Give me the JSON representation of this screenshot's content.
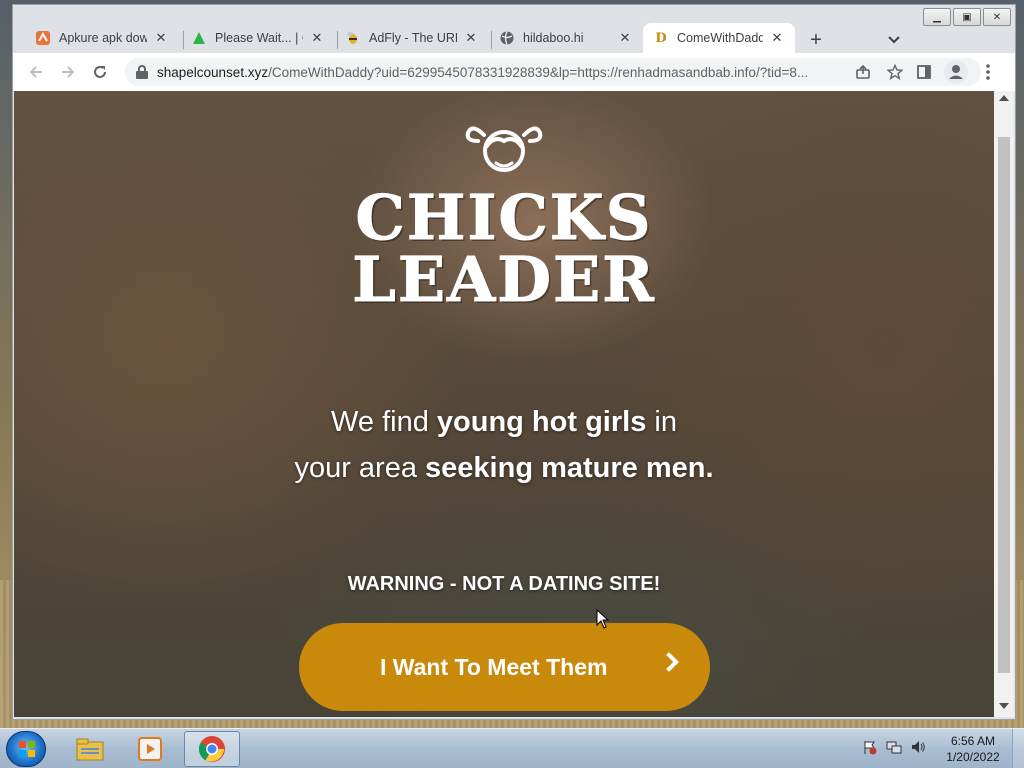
{
  "browser": {
    "tabs": [
      {
        "label": "Apkure apk dow",
        "favicon": "apkure-favicon",
        "active": false
      },
      {
        "label": "Please Wait... | Cl",
        "favicon": "android-favicon",
        "active": false
      },
      {
        "label": "AdFly - The URL",
        "favicon": "adfly-bee-favicon",
        "active": false
      },
      {
        "label": "hildaboo.hi",
        "favicon": "globe-favicon",
        "active": false
      },
      {
        "label": "ComeWithDaddy",
        "favicon": "d-letter-favicon",
        "active": true
      }
    ],
    "new_tab_symbol": "+",
    "tab_search_symbol": "⌄",
    "url_host": "shapelcounset.xyz",
    "url_rest": "/ComeWithDaddy?uid=6299545078331928839&lp=https://renhadmasandbab.info/?tid=8...",
    "close_symbol": "✕"
  },
  "page": {
    "logo_line1": "CHICKS",
    "logo_line2": "LEADER",
    "headline_1a": "We find ",
    "headline_1b": "young hot girls",
    "headline_1c": " in",
    "headline_2a": "your area ",
    "headline_2b": "seeking mature men.",
    "warning": "WARNING - NOT A DATING SITE!",
    "cta_label": "I Want To Meet Them",
    "cta_color": "#c98a0c"
  },
  "taskbar": {
    "time": "6:56 AM",
    "date": "1/20/2022",
    "apps": [
      "explorer-icon",
      "media-player-icon",
      "chrome-icon"
    ]
  }
}
